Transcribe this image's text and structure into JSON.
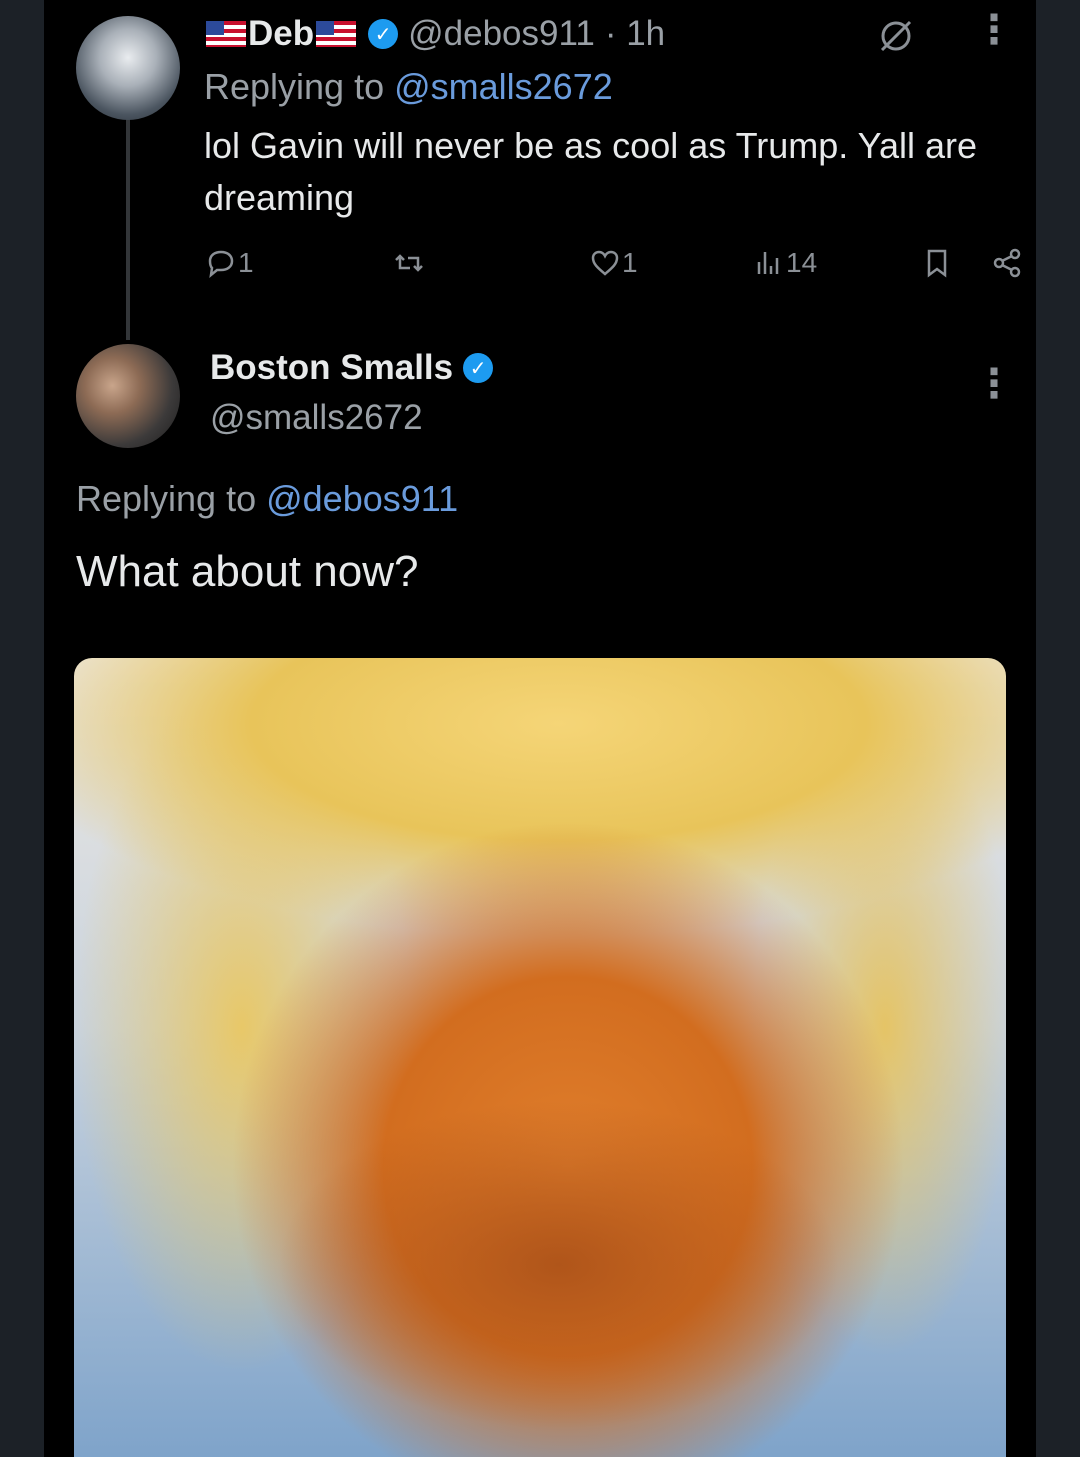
{
  "parent_tweet": {
    "display_name": "Deb",
    "handle": "@debos911",
    "time": "· 1h",
    "replying_label": "Replying to",
    "replying_to": "@smalls2672",
    "text": "lol Gavin will never be as cool as Trump. Yall are dreaming",
    "actions": {
      "reply_count": "1",
      "repost_count": "",
      "like_count": "1",
      "views_count": "14"
    }
  },
  "reply_tweet": {
    "display_name": "Boston Smalls",
    "handle": "@smalls2672",
    "replying_label": "Replying to",
    "replying_to": "@debos911",
    "text": "What about now?"
  },
  "icons": {
    "verified": "verified-badge-icon",
    "grok": "grok-icon",
    "more": "more-icon",
    "reply": "reply-icon",
    "repost": "repost-icon",
    "like": "like-icon",
    "views": "views-icon",
    "bookmark": "bookmark-icon",
    "share": "share-icon"
  },
  "colors": {
    "background": "#000000",
    "text": "#e7e9ea",
    "secondary_text": "#9aa0a6",
    "mention": "#6a9bdc",
    "verified": "#1d9bf0"
  }
}
